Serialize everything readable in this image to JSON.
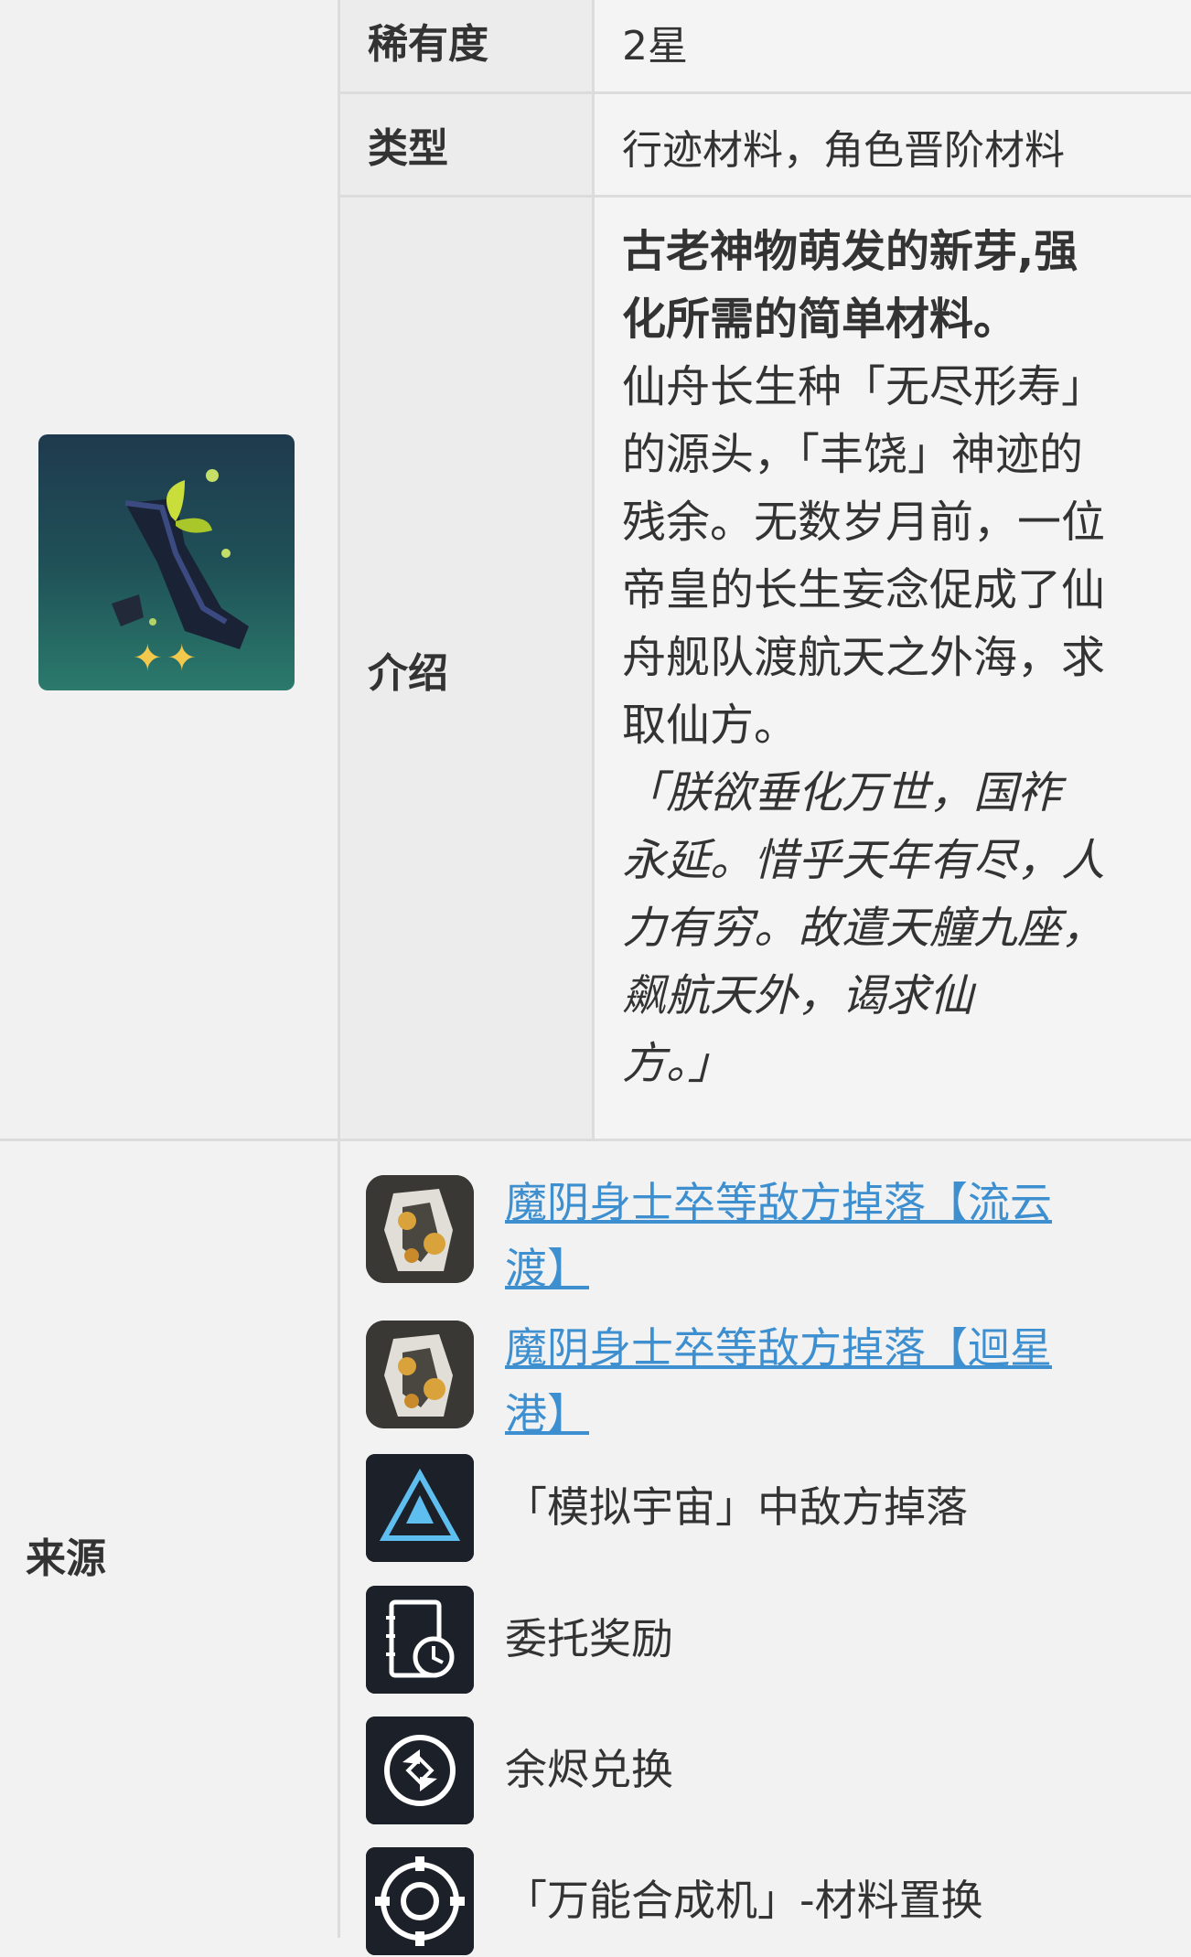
{
  "item": {
    "rarity_label": "稀有度",
    "rarity_value": "2星",
    "type_label": "类型",
    "type_value": "行迹材料，角色晋阶材料",
    "intro_label": "介绍",
    "intro_bold_1": "古老神物萌发的新芽,强",
    "intro_bold_2": "化所需的简单材料。",
    "intro_lines": [
      "仙舟长生种「无尽形寿」",
      "的源头，「丰饶」神迹的",
      "残余。无数岁月前，一位",
      "帝皇的长生妄念促成了仙",
      "舟舰队渡航天之外海，求",
      "取仙方。"
    ],
    "intro_quote": [
      "「朕欲垂化万世，国祚",
      "永延。惜乎天年有尽，人",
      "力有穷。故遣天艟九座，",
      "飙航天外，谒求仙",
      "方。」"
    ],
    "stars": "✦✦",
    "accent_color": "#3d8fd0"
  },
  "sources": {
    "label": "来源",
    "items": [
      {
        "line1": "魔阴身士卒等敌方掉落【流云",
        "line2": "渡】",
        "icon": "enemy-icon"
      },
      {
        "line1": "魔阴身士卒等敌方掉落【迴星",
        "line2": "港】",
        "icon": "enemy-icon"
      },
      {
        "text": "「模拟宇宙」中敌方掉落",
        "icon": "simulated-universe-icon"
      },
      {
        "text": "委托奖励",
        "icon": "assignment-icon"
      },
      {
        "text": "余烬兑换",
        "icon": "exchange-icon"
      },
      {
        "text": "「万能合成机」-材料置换",
        "icon": "synthesizer-icon"
      }
    ]
  }
}
